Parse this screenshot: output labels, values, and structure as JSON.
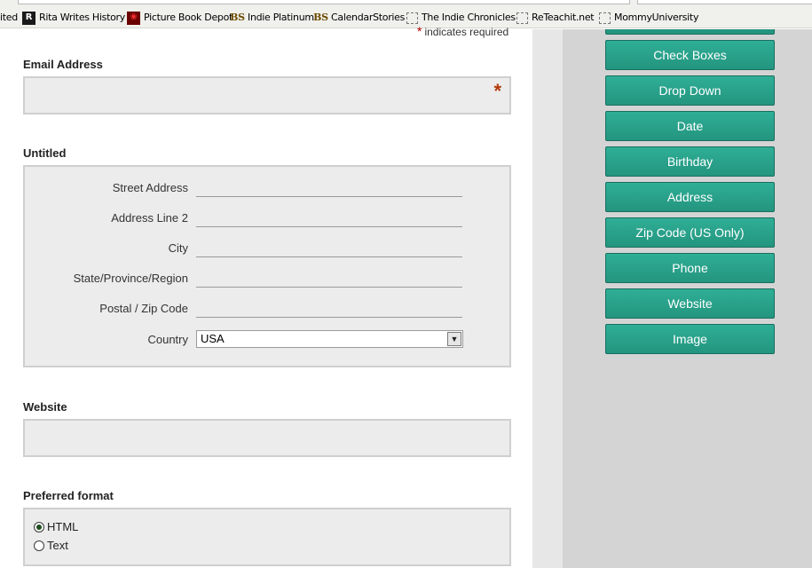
{
  "bookmarks": [
    {
      "label": "ited",
      "icon": "none"
    },
    {
      "label": "Rita Writes History",
      "icon": "rita-icon"
    },
    {
      "label": "Picture Book Depot",
      "icon": "picture-book-icon"
    },
    {
      "label": "Indie Platinum",
      "icon": "bs-icon",
      "glyph": "BS"
    },
    {
      "label": "CalendarStories",
      "icon": "bs-icon",
      "glyph": "BS"
    },
    {
      "label": "The Indie Chronicles",
      "icon": "blank-page-icon"
    },
    {
      "label": "ReTeachit.net",
      "icon": "blank-page-icon"
    },
    {
      "label": "MommyUniversity",
      "icon": "blank-page-icon"
    }
  ],
  "form": {
    "required_note": "indicates required",
    "required_star": "*",
    "email": {
      "label": "Email Address",
      "star": "*",
      "value": ""
    },
    "address": {
      "label": "Untitled",
      "rows": [
        {
          "label": "Street Address",
          "value": ""
        },
        {
          "label": "Address Line 2",
          "value": ""
        },
        {
          "label": "City",
          "value": ""
        },
        {
          "label": "State/Province/Region",
          "value": ""
        },
        {
          "label": "Postal / Zip Code",
          "value": ""
        }
      ],
      "country_label": "Country",
      "country_value": "USA"
    },
    "website": {
      "label": "Website",
      "value": ""
    },
    "format": {
      "label": "Preferred format",
      "options": [
        {
          "label": "HTML",
          "selected": true
        },
        {
          "label": "Text",
          "selected": false
        }
      ]
    }
  },
  "sidebar": {
    "buttons": [
      "Check Boxes",
      "Drop Down",
      "Date",
      "Birthday",
      "Address",
      "Zip Code (US Only)",
      "Phone",
      "Website",
      "Image"
    ]
  },
  "colors": {
    "button_bg": "#2aa48c",
    "required_star": "#b33a0a",
    "sidebar_bg": "#d4d4d4"
  }
}
